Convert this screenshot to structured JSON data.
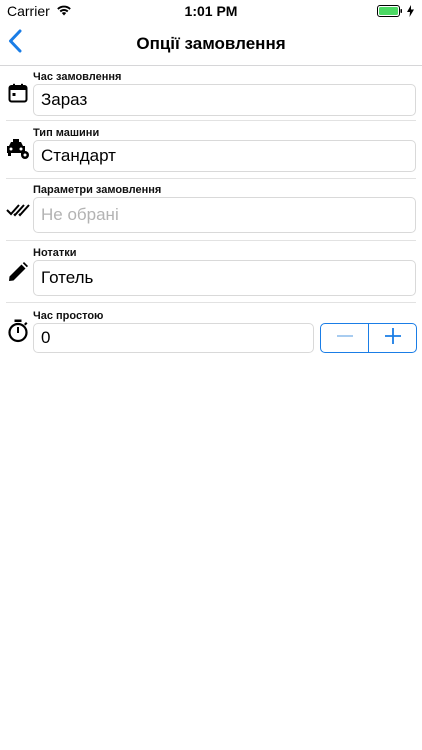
{
  "status_bar": {
    "carrier": "Carrier",
    "time": "1:01 PM"
  },
  "nav": {
    "title": "Опції замовлення",
    "accent_color": "#1a7de6"
  },
  "rows": [
    {
      "label": "Час замовлення",
      "value": "Зараз",
      "icon": "calendar-icon"
    },
    {
      "label": "Тип машини",
      "value": "Стандарт",
      "icon": "taxi-settings-icon"
    },
    {
      "label": "Параметри замовлення",
      "placeholder": "Не обрані",
      "icon": "double-check-icon"
    },
    {
      "label": "Нотатки",
      "value": "Готель",
      "icon": "pencil-icon"
    },
    {
      "label": "Час простою",
      "value": "0",
      "icon": "stopwatch-icon"
    }
  ]
}
